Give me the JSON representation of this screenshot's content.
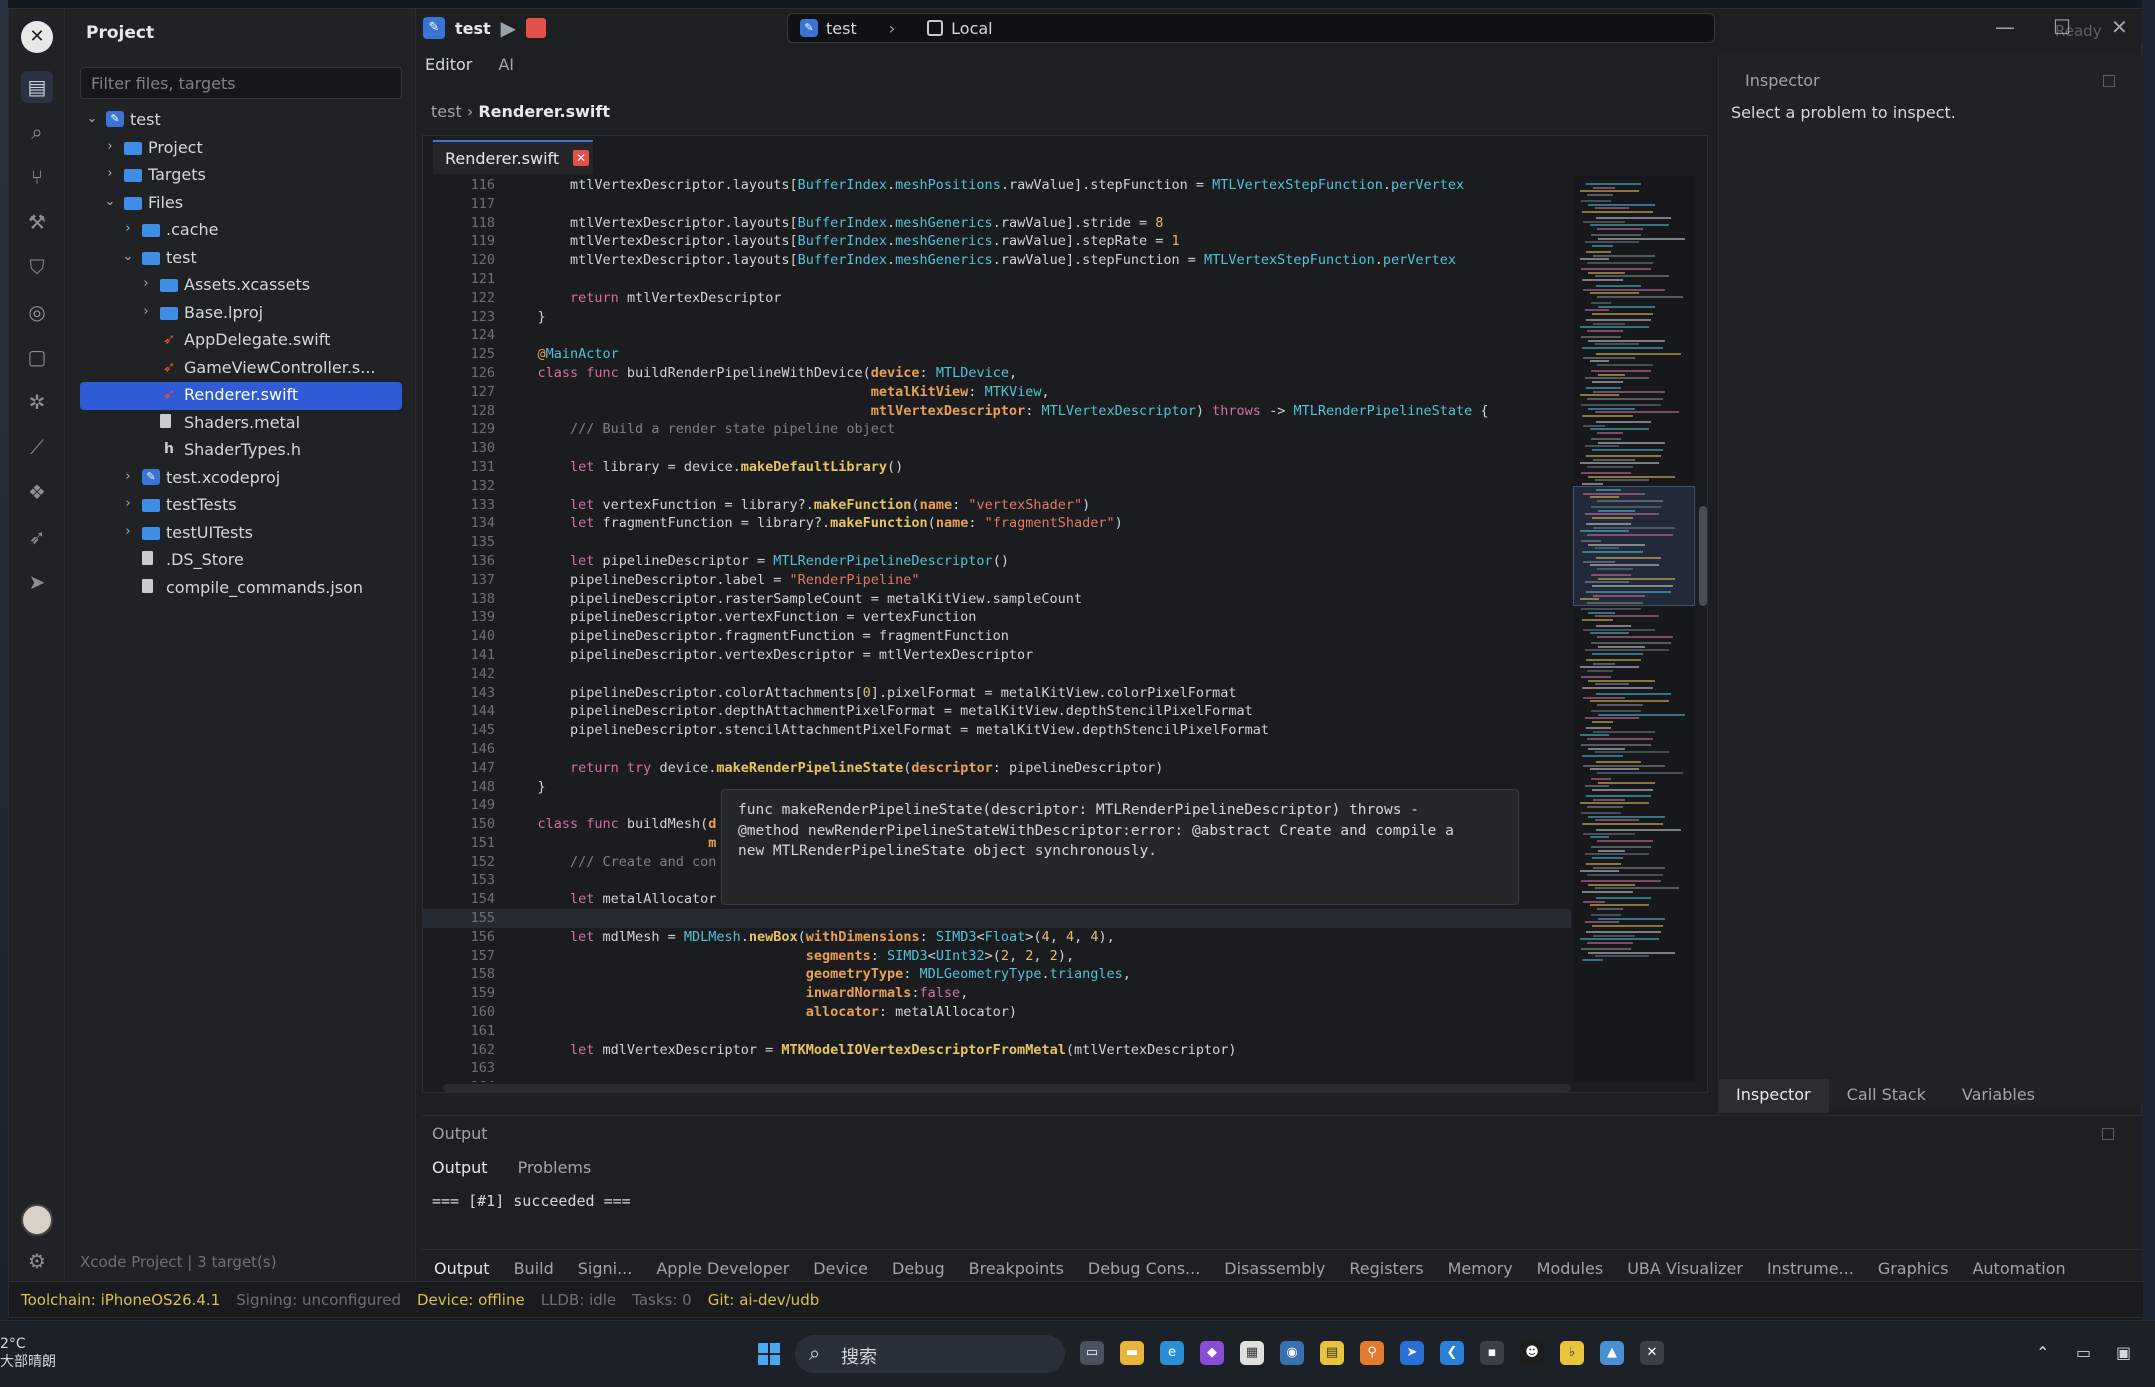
{
  "sidebar": {
    "title": "Project",
    "filter_placeholder": "Filter files, targets",
    "footer": "Xcode Project | 3 target(s)",
    "tree": [
      {
        "label": "test",
        "level": 0,
        "chev": "⌄",
        "icon": "project-badge",
        "selected": false
      },
      {
        "label": "Project",
        "level": 1,
        "chev": "›",
        "icon": "folder",
        "selected": false
      },
      {
        "label": "Targets",
        "level": 1,
        "chev": "›",
        "icon": "folder",
        "selected": false
      },
      {
        "label": "Files",
        "level": 1,
        "chev": "⌄",
        "icon": "folder",
        "selected": false
      },
      {
        "label": ".cache",
        "level": 2,
        "chev": "›",
        "icon": "folder",
        "selected": false
      },
      {
        "label": "test",
        "level": 2,
        "chev": "⌄",
        "icon": "folder",
        "selected": false
      },
      {
        "label": "Assets.xcassets",
        "level": 3,
        "chev": "›",
        "icon": "folder",
        "selected": false
      },
      {
        "label": "Base.lproj",
        "level": 3,
        "chev": "›",
        "icon": "folder",
        "selected": false
      },
      {
        "label": "AppDelegate.swift",
        "level": 3,
        "chev": "",
        "icon": "swift",
        "selected": false
      },
      {
        "label": "GameViewController.s...",
        "level": 3,
        "chev": "",
        "icon": "swift",
        "selected": false
      },
      {
        "label": "Renderer.swift",
        "level": 3,
        "chev": "",
        "icon": "swift",
        "selected": true
      },
      {
        "label": "Shaders.metal",
        "level": 3,
        "chev": "",
        "icon": "file",
        "selected": false
      },
      {
        "label": "ShaderTypes.h",
        "level": 3,
        "chev": "",
        "icon": "header",
        "selected": false
      },
      {
        "label": "test.xcodeproj",
        "level": 2,
        "chev": "›",
        "icon": "project-badge",
        "selected": false
      },
      {
        "label": "testTests",
        "level": 2,
        "chev": "›",
        "icon": "folder",
        "selected": false
      },
      {
        "label": "testUITests",
        "level": 2,
        "chev": "›",
        "icon": "folder",
        "selected": false
      },
      {
        "label": ".DS_Store",
        "level": 2,
        "chev": "",
        "icon": "file",
        "selected": false
      },
      {
        "label": "compile_commands.json",
        "level": 2,
        "chev": "",
        "icon": "file",
        "selected": false
      }
    ]
  },
  "activity_icons": [
    "files-icon",
    "search-icon",
    "source-control-icon",
    "build-icon",
    "shield-icon",
    "check-circle-icon",
    "square-icon",
    "debug-bug-icon",
    "chart-icon",
    "packages-icon",
    "run-arrow-icon",
    "send-icon"
  ],
  "toolbar": {
    "scheme_name": "test",
    "run_target": "test",
    "run_destination": "Local",
    "status": "Ready"
  },
  "editor": {
    "tabs": [
      "Editor",
      "AI"
    ],
    "breadcrumb_root": "test",
    "breadcrumb_file": "Renderer.swift",
    "open_file": "Renderer.swift",
    "current_line": 155,
    "lines": [
      {
        "n": "116",
        "html": "        mtlVertexDescriptor.layouts[<span class='ty'>BufferIndex</span>.<span class='ty'>meshPositions</span>.rawValue].stepFunction = <span class='ty'>MTLVertexStepFunction</span>.<span class='ty'>perVertex</span>"
      },
      {
        "n": "117",
        "html": ""
      },
      {
        "n": "118",
        "html": "        mtlVertexDescriptor.layouts[<span class='ty'>BufferIndex</span>.<span class='ty'>meshGenerics</span>.rawValue].stride = <span class='nu'>8</span>"
      },
      {
        "n": "119",
        "html": "        mtlVertexDescriptor.layouts[<span class='ty'>BufferIndex</span>.<span class='ty'>meshGenerics</span>.rawValue].stepRate = <span class='nu'>1</span>"
      },
      {
        "n": "120",
        "html": "        mtlVertexDescriptor.layouts[<span class='ty'>BufferIndex</span>.<span class='ty'>meshGenerics</span>.rawValue].stepFunction = <span class='ty'>MTLVertexStepFunction</span>.<span class='ty'>perVertex</span>"
      },
      {
        "n": "121",
        "html": ""
      },
      {
        "n": "122",
        "html": "        <span class='kw'>return</span> mtlVertexDescriptor"
      },
      {
        "n": "123",
        "html": "    }"
      },
      {
        "n": "124",
        "html": ""
      },
      {
        "n": "125",
        "html": "    <span class='at'>@</span><span class='ty'>MainActor</span>"
      },
      {
        "n": "126",
        "html": "    <span class='kw'>class func</span> buildRenderPipelineWithDevice(<span class='pa'>device</span>: <span class='ty'>MTLDevice</span>,"
      },
      {
        "n": "127",
        "html": "                                             <span class='pa'>metalKitView</span>: <span class='ty'>MTKView</span>,"
      },
      {
        "n": "128",
        "html": "                                             <span class='pa'>mtlVertexDescriptor</span>: <span class='ty'>MTLVertexDescriptor</span>) <span class='kw'>throws</span> -&gt; <span class='ty'>MTLRenderPipelineState</span> {"
      },
      {
        "n": "129",
        "html": "        <span class='cm'>/// Build a render state pipeline object</span>"
      },
      {
        "n": "130",
        "html": ""
      },
      {
        "n": "131",
        "html": "        <span class='kw'>let</span> library = device.<span class='fn'>makeDefaultLibrary</span>()"
      },
      {
        "n": "132",
        "html": ""
      },
      {
        "n": "133",
        "html": "        <span class='kw'>let</span> vertexFunction = library?.<span class='fn'>makeFunction</span>(<span class='pa'>name</span>: <span class='st'>\"vertexShader\"</span>)"
      },
      {
        "n": "134",
        "html": "        <span class='kw'>let</span> fragmentFunction = library?.<span class='fn'>makeFunction</span>(<span class='pa'>name</span>: <span class='st'>\"fragmentShader\"</span>)"
      },
      {
        "n": "135",
        "html": ""
      },
      {
        "n": "136",
        "html": "        <span class='kw'>let</span> pipelineDescriptor = <span class='ty'>MTLRenderPipelineDescriptor</span>()"
      },
      {
        "n": "137",
        "html": "        pipelineDescriptor.label = <span class='st'>\"RenderPipeline\"</span>"
      },
      {
        "n": "138",
        "html": "        pipelineDescriptor.rasterSampleCount = metalKitView.sampleCount"
      },
      {
        "n": "139",
        "html": "        pipelineDescriptor.vertexFunction = vertexFunction"
      },
      {
        "n": "140",
        "html": "        pipelineDescriptor.fragmentFunction = fragmentFunction"
      },
      {
        "n": "141",
        "html": "        pipelineDescriptor.vertexDescriptor = mtlVertexDescriptor"
      },
      {
        "n": "142",
        "html": ""
      },
      {
        "n": "143",
        "html": "        pipelineDescriptor.colorAttachments[<span class='nu'>0</span>].pixelFormat = metalKitView.colorPixelFormat"
      },
      {
        "n": "144",
        "html": "        pipelineDescriptor.depthAttachmentPixelFormat = metalKitView.depthStencilPixelFormat"
      },
      {
        "n": "145",
        "html": "        pipelineDescriptor.stencilAttachmentPixelFormat = metalKitView.depthStencilPixelFormat"
      },
      {
        "n": "146",
        "html": ""
      },
      {
        "n": "147",
        "html": "        <span class='kw'>return try</span> device.<span class='fn'>makeRenderPipelineState</span>(<span class='pa'>descriptor</span>: pipelineDescriptor)"
      },
      {
        "n": "148",
        "html": "    }"
      },
      {
        "n": "149",
        "html": ""
      },
      {
        "n": "150",
        "html": "    <span class='kw'>class func</span> buildMesh(<span class='pa'>d</span>"
      },
      {
        "n": "151",
        "html": "                         <span class='pa'>m</span>"
      },
      {
        "n": "152",
        "html": "        <span class='cm'>/// Create and con</span>"
      },
      {
        "n": "153",
        "html": ""
      },
      {
        "n": "154",
        "html": "        <span class='kw'>let</span> metalAllocator = <span class='ty'>MTKMeshBufferAllocator</span>(<span class='pa'>device</span>: device)"
      },
      {
        "n": "155",
        "html": ""
      },
      {
        "n": "156",
        "html": "        <span class='kw'>let</span> mdlMesh = <span class='ty'>MDLMesh</span>.<span class='fn'>newBox</span>(<span class='pa'>withDimensions</span>: <span class='ty'>SIMD3</span>&lt;<span class='ty'>Float</span>&gt;(<span class='nu'>4</span>, <span class='nu'>4</span>, <span class='nu'>4</span>),"
      },
      {
        "n": "157",
        "html": "                                     <span class='pa'>segments</span>: <span class='ty'>SIMD3</span>&lt;<span class='ty'>UInt32</span>&gt;(<span class='nu'>2</span>, <span class='nu'>2</span>, <span class='nu'>2</span>),"
      },
      {
        "n": "158",
        "html": "                                     <span class='pa'>geometryType</span>: <span class='ty'>MDLGeometryType</span>.<span class='ty'>triangles</span>,"
      },
      {
        "n": "159",
        "html": "                                     <span class='pa'>inwardNormals</span>:<span class='kw'>false</span>,"
      },
      {
        "n": "160",
        "html": "                                     <span class='pa'>allocator</span>: metalAllocator)"
      },
      {
        "n": "161",
        "html": ""
      },
      {
        "n": "162",
        "html": "        <span class='kw'>let</span> mdlVertexDescriptor = <span class='fn'>MTKModelIOVertexDescriptorFromMetal</span>(mtlVertexDescriptor)"
      },
      {
        "n": "163",
        "html": ""
      },
      {
        "n": "164",
        "html": ""
      }
    ],
    "tooltip": "func makeRenderPipelineState(descriptor: MTLRenderPipelineDescriptor) throws -\n@method newRenderPipelineStateWithDescriptor:error: @abstract Create and compile a\nnew MTLRenderPipelineState object synchronously."
  },
  "inspector": {
    "title": "Inspector",
    "message": "Select a problem to inspect.",
    "tabs": [
      "Inspector",
      "Call Stack",
      "Variables"
    ],
    "active_tab": 0
  },
  "output": {
    "title": "Output",
    "tabs": [
      "Output",
      "Problems"
    ],
    "active_tab": 0,
    "text": "=== [#1] succeeded ==="
  },
  "bottom_tabs": {
    "items": [
      "Output",
      "Build",
      "Signi...",
      "Apple Developer",
      "Device",
      "Debug",
      "Breakpoints",
      "Debug Cons...",
      "Disassembly",
      "Registers",
      "Memory",
      "Modules",
      "UBA Visualizer",
      "Instrume...",
      "Graphics",
      "Automation"
    ],
    "active": 0
  },
  "statusbar": {
    "toolchain": "Toolchain: iPhoneOS26.4.1",
    "signing": "Signing: unconfigured",
    "device": "Device: offline",
    "lldb": "LLDB: idle",
    "tasks": "Tasks: 0",
    "git": "Git: ai-dev/udb"
  },
  "taskbar": {
    "weather_temp": "2°C",
    "weather_desc": "大部晴朗",
    "search_label": "搜索"
  },
  "colors": {
    "accent": "#2e5bd6",
    "background": "#1e1f22",
    "status_yellow": "#d9c04f",
    "stop_red": "#e2504a"
  }
}
